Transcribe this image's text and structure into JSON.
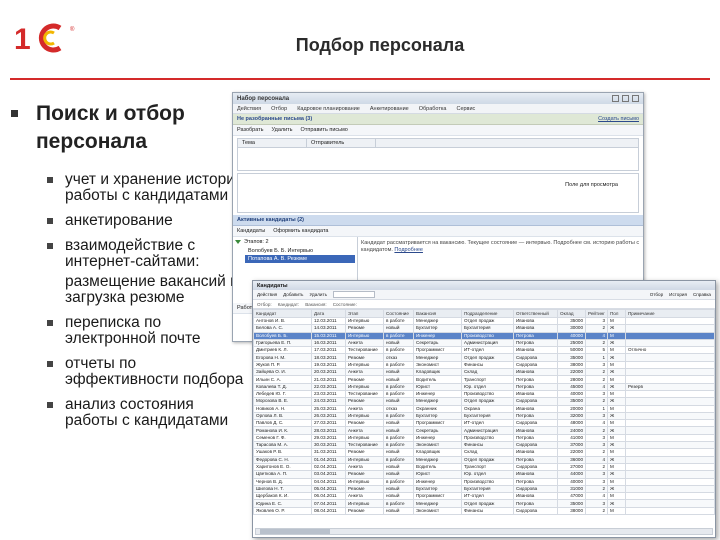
{
  "slide": {
    "title": "Подбор персонала",
    "heading": "Поиск и отбор персонала",
    "bullets": [
      "учет и хранение истории работы с кандидатами",
      "анкетирование",
      "взаимодействие с интернет-сайтами:",
      "размещение вакансий и загрузка резюме",
      "переписка по электронной почте",
      "отчеты по эффективности подбора",
      "анализ состояния работы с кандидатами"
    ]
  },
  "window1": {
    "title": "Набор персонала",
    "menu": [
      "Действия",
      "Отбор",
      "Кадровое планирование",
      "Анкетирование",
      "Обработка",
      "Сервис"
    ],
    "inbox_header": "Не разобранные письма (3)",
    "inbox_link": "Создать письмо",
    "toolbar": [
      "Разобрать",
      "Удалить",
      "Отправить письмо"
    ],
    "columns": [
      "Тема",
      "Отправитель"
    ],
    "preview_label": "Поле для просмотра",
    "active_header": "Активные кандидаты (2)",
    "active_toolbar": [
      "Кандидаты",
      "Оформить кандидата"
    ],
    "group_label": "Этапов: 2",
    "items": [
      "Волобуев Б. Б. Интервью",
      "Потапова А. В. Резюме"
    ],
    "body_text": "Кандидат рассматривается на вакансию. Текущее состояние — интервью. Подробнее см. историю работы с кандидатом.",
    "link_text": "Подробнее",
    "footer": "Работа с кандидатом"
  },
  "window2": {
    "title": "Кандидаты",
    "toolbar": [
      "Действия",
      "Добавить",
      "Удалить"
    ],
    "toolbar_right": [
      "Отбор",
      "История",
      "Справка"
    ],
    "filter": [
      "Отбор:",
      "Кандидат:",
      "Вакансия:",
      "Состояние:"
    ],
    "columns": [
      "Кандидат",
      "Дата",
      "Этап",
      "Состояние",
      "Вакансия",
      "Подразделение",
      "Ответственный",
      "Оклад",
      "Рейтинг",
      "Пол",
      "Примечание"
    ],
    "rows": [
      [
        "Антонов И. В.",
        "12.03.2011",
        "Интервью",
        "в работе",
        "Менеджер",
        "Отдел продаж",
        "Иванова",
        "35000",
        "3",
        "М",
        ""
      ],
      [
        "Белова А. С.",
        "14.03.2011",
        "Резюме",
        "новый",
        "Бухгалтер",
        "Бухгалтерия",
        "Иванова",
        "30000",
        "2",
        "Ж",
        ""
      ],
      [
        "Волобуев Б. Б.",
        "15.03.2011",
        "Интервью",
        "в работе",
        "Инженер",
        "Производство",
        "Петрова",
        "40000",
        "4",
        "М",
        ""
      ],
      [
        "Григорьева Е. П.",
        "16.03.2011",
        "Анкета",
        "новый",
        "Секретарь",
        "Администрация",
        "Петрова",
        "25000",
        "2",
        "Ж",
        ""
      ],
      [
        "Дмитриев К. Л.",
        "17.03.2011",
        "Тестирование",
        "в работе",
        "Программист",
        "ИТ-отдел",
        "Иванова",
        "50000",
        "5",
        "М",
        "Отлично"
      ],
      [
        "Егорова Н. М.",
        "18.03.2011",
        "Резюме",
        "отказ",
        "Менеджер",
        "Отдел продаж",
        "Сидорова",
        "35000",
        "1",
        "Ж",
        ""
      ],
      [
        "Жуков П. Р.",
        "19.03.2011",
        "Интервью",
        "в работе",
        "Экономист",
        "Финансы",
        "Сидорова",
        "38000",
        "3",
        "М",
        ""
      ],
      [
        "Зайцева О. И.",
        "20.03.2011",
        "Анкета",
        "новый",
        "Кладовщик",
        "Склад",
        "Иванова",
        "22000",
        "2",
        "Ж",
        ""
      ],
      [
        "Ильин С. А.",
        "21.03.2011",
        "Резюме",
        "новый",
        "Водитель",
        "Транспорт",
        "Петрова",
        "28000",
        "2",
        "М",
        ""
      ],
      [
        "Ковалева Т. Д.",
        "22.03.2011",
        "Интервью",
        "в работе",
        "Юрист",
        "Юр. отдел",
        "Петрова",
        "45000",
        "4",
        "Ж",
        "Резерв"
      ],
      [
        "Лебедев Ю. Г.",
        "23.03.2011",
        "Тестирование",
        "в работе",
        "Инженер",
        "Производство",
        "Иванова",
        "40000",
        "3",
        "М",
        ""
      ],
      [
        "Морозова В. Е.",
        "24.03.2011",
        "Резюме",
        "новый",
        "Менеджер",
        "Отдел продаж",
        "Сидорова",
        "35000",
        "2",
        "Ж",
        ""
      ],
      [
        "Новиков А. Н.",
        "25.03.2011",
        "Анкета",
        "отказ",
        "Охранник",
        "Охрана",
        "Иванова",
        "20000",
        "1",
        "М",
        ""
      ],
      [
        "Орлова Л. В.",
        "26.03.2011",
        "Интервью",
        "в работе",
        "Бухгалтер",
        "Бухгалтерия",
        "Петрова",
        "32000",
        "3",
        "Ж",
        ""
      ],
      [
        "Павлов Д. С.",
        "27.03.2011",
        "Резюме",
        "новый",
        "Программист",
        "ИТ-отдел",
        "Сидорова",
        "48000",
        "4",
        "М",
        ""
      ],
      [
        "Романова И. К.",
        "28.03.2011",
        "Анкета",
        "новый",
        "Секретарь",
        "Администрация",
        "Иванова",
        "24000",
        "2",
        "Ж",
        ""
      ],
      [
        "Семенов Г. Ф.",
        "29.03.2011",
        "Интервью",
        "в работе",
        "Инженер",
        "Производство",
        "Петрова",
        "41000",
        "3",
        "М",
        ""
      ],
      [
        "Тарасова М. А.",
        "30.03.2011",
        "Тестирование",
        "в работе",
        "Экономист",
        "Финансы",
        "Сидорова",
        "37000",
        "3",
        "Ж",
        ""
      ],
      [
        "Ушаков Р. В.",
        "31.03.2011",
        "Резюме",
        "новый",
        "Кладовщик",
        "Склад",
        "Иванова",
        "22000",
        "2",
        "М",
        ""
      ],
      [
        "Федорова С. Н.",
        "01.04.2011",
        "Интервью",
        "в работе",
        "Менеджер",
        "Отдел продаж",
        "Петрова",
        "36000",
        "4",
        "Ж",
        ""
      ],
      [
        "Харитонов Е. О.",
        "02.04.2011",
        "Анкета",
        "новый",
        "Водитель",
        "Транспорт",
        "Сидорова",
        "27000",
        "2",
        "М",
        ""
      ],
      [
        "Цветкова А. П.",
        "03.04.2011",
        "Резюме",
        "новый",
        "Юрист",
        "Юр. отдел",
        "Иванова",
        "44000",
        "3",
        "Ж",
        ""
      ],
      [
        "Чернов В. Д.",
        "04.04.2011",
        "Интервью",
        "в работе",
        "Инженер",
        "Производство",
        "Петрова",
        "40000",
        "3",
        "М",
        ""
      ],
      [
        "Шилова Н. Т.",
        "05.04.2011",
        "Резюме",
        "новый",
        "Бухгалтер",
        "Бухгалтерия",
        "Сидорова",
        "31000",
        "2",
        "Ж",
        ""
      ],
      [
        "Щербаков К. И.",
        "06.04.2011",
        "Анкета",
        "новый",
        "Программист",
        "ИТ-отдел",
        "Иванова",
        "47000",
        "4",
        "М",
        ""
      ],
      [
        "Юдина Е. С.",
        "07.04.2011",
        "Интервью",
        "в работе",
        "Менеджер",
        "Отдел продаж",
        "Петрова",
        "35000",
        "3",
        "Ж",
        ""
      ],
      [
        "Яковлев О. Р.",
        "08.04.2011",
        "Резюме",
        "новый",
        "Экономист",
        "Финансы",
        "Сидорова",
        "38000",
        "2",
        "М",
        ""
      ]
    ],
    "selected_row": 2
  },
  "colors": {
    "accent_red": "#d42a2a",
    "selection_blue": "#5b84c8",
    "header_green": "#dfe8d6"
  }
}
